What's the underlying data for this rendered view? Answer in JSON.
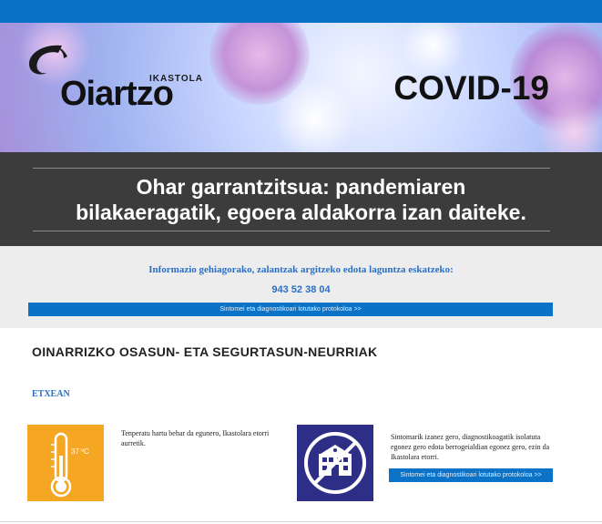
{
  "brand": {
    "logo_text": "Oiartzo",
    "logo_subtext": "IKASTOLA",
    "hero_title": "COVID-19"
  },
  "notice": {
    "title_line1": "Ohar garrantzitsua: pandemiaren",
    "title_line2": "bilakaeragatik, egoera aldakorra izan daiteke."
  },
  "info": {
    "lead": "Informazio gehiagorako, zalantzak argitzeko edota laguntza eskatzeko:",
    "phone": "943 52 38 04",
    "protocol_link": "Sintomei eta diagnostikoari lotutako protokoloa >>"
  },
  "measures": {
    "section_title": "OINARRIZKO OSASUN- ETA SEGURTASUN-NEURRIAK",
    "subsection": "ETXEAN",
    "thermometer_label": "37 ºC",
    "item1_text": "Tenperatu hartu behar da egunero, Ikastolara etorri aurretik.",
    "item2_text": "Sintomarik izanez gero, diagnostikoagatik isolatuta egonez gero edota berrogeialdian egonez gero, ezin da Ikastolara etorri.",
    "item2_link": "Sintomei eta diagnostikoari lotutako protokoloa >>"
  },
  "colors": {
    "topbar": "#0a73c7",
    "accent_blue": "#2a6fc4",
    "notice_bg": "#3c3c3c",
    "thermo_bg": "#f5a623",
    "school_bg": "#2d2f86"
  },
  "icons": {
    "thermometer": "thermometer-icon",
    "school_forbidden": "no-school-icon"
  }
}
